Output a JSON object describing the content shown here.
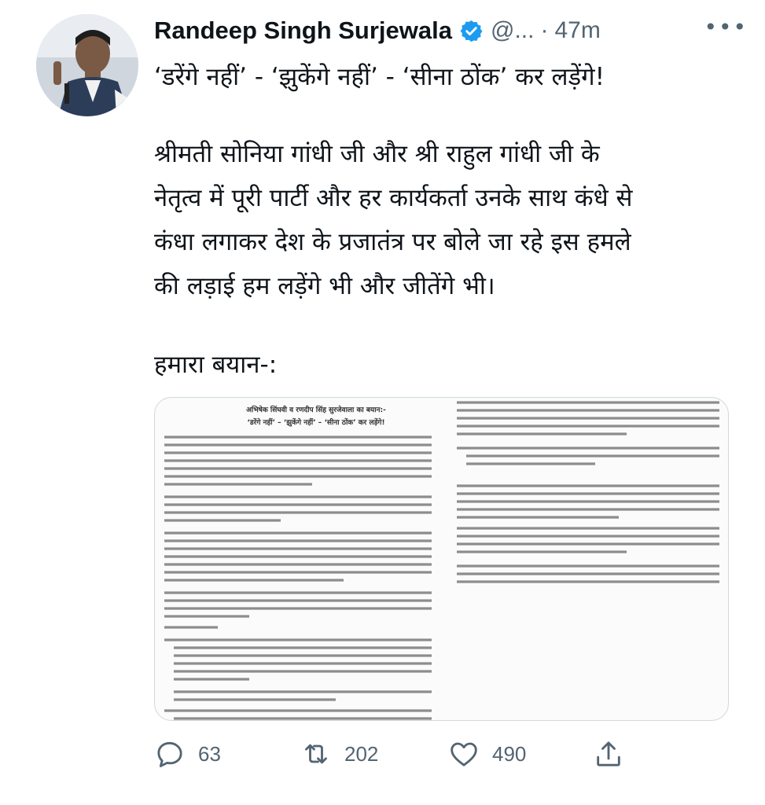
{
  "tweet": {
    "author_name": "Randeep Singh Surjewala",
    "author_handle": "@...",
    "separator": "·",
    "time_ago": "47m",
    "more_label": "•••",
    "lines": [
      "‘डरेंगे नहीं’ - ‘झुकेंगे नहीं’ - ‘सीना ठोंक’ कर लड़ेंगे!",
      "श्रीमती सोनिया गांधी जी और श्री राहुल गांधी जी के",
      "नेतृत्व में पूरी पार्टी और हर कार्यकर्ता उनके साथ कंधे से",
      "कंधा लगाकर देश के प्रजातंत्र पर बोले जा रहे इस हमले",
      "की लड़ाई हम लड़ेंगे भी और जीतेंगे भी।",
      "हमारा बयान-:"
    ]
  },
  "attachment": {
    "title_line1": "अभिषेक सिंघवी व रणदीप सिंह सुरजेवाला का बयान:-",
    "title_line2": "‘डरेंगे नहीं’ – ‘झुकेंगे नहीं’ – ‘सीना ठोंक’ कर लड़ेंगे!"
  },
  "actions": {
    "reply_count": "63",
    "retweet_count": "202",
    "like_count": "490"
  },
  "colors": {
    "verified_badge": "#1d9bf0",
    "secondary_text": "#536471",
    "primary_text": "#0f1419"
  },
  "icons": [
    "avatar-photo",
    "verified-badge-icon",
    "more-icon",
    "reply-icon",
    "retweet-icon",
    "like-icon",
    "share-icon"
  ]
}
